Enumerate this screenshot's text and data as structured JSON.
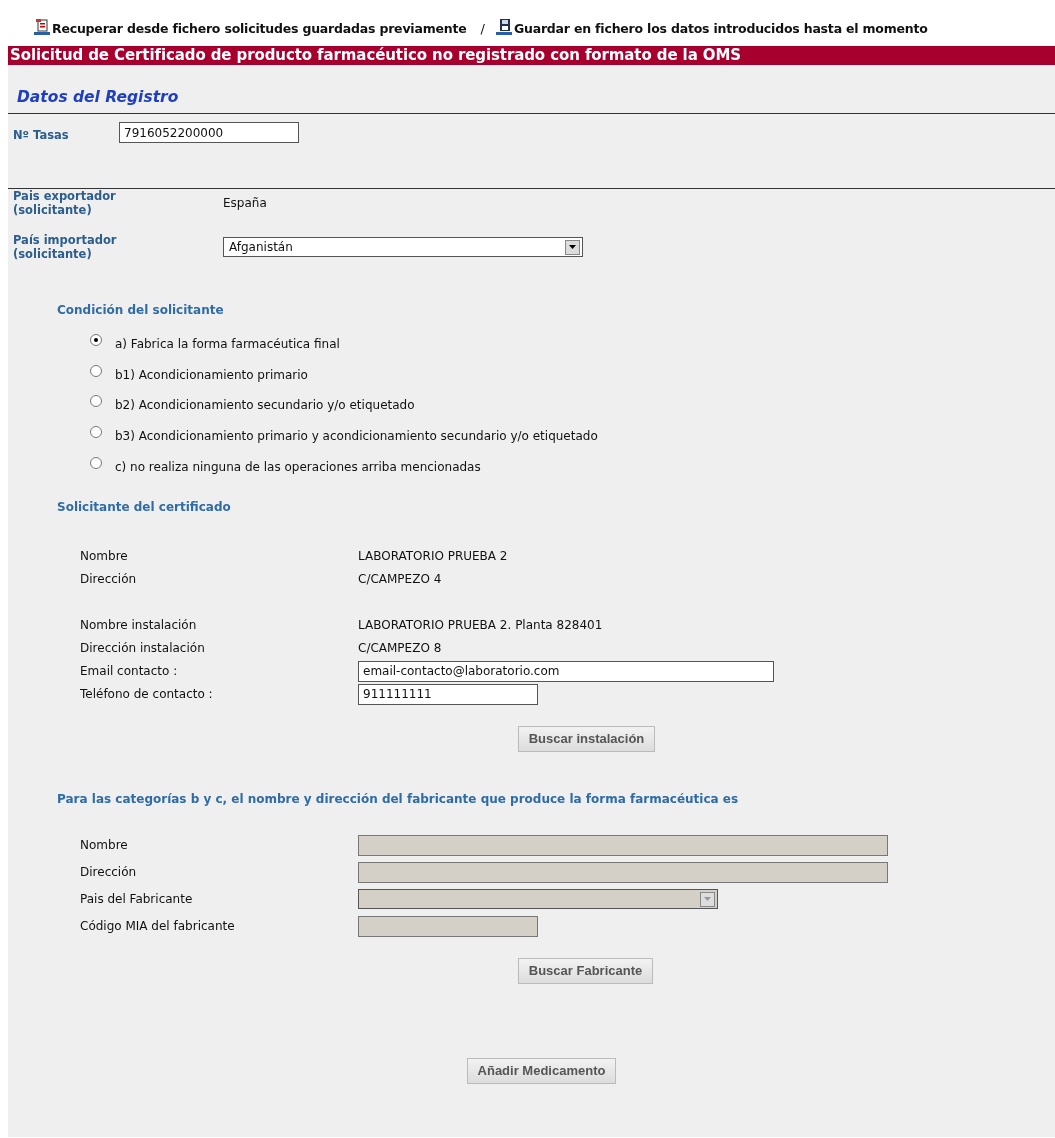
{
  "toolbar": {
    "links": [
      {
        "kind": "recover",
        "label": "Recuperar desde fichero solicitudes guardadas previamente"
      },
      {
        "kind": "save",
        "label": "Guardar en fichero los datos introducidos hasta el momento"
      }
    ],
    "separator": "/"
  },
  "title": "Solicitud de Certificado de producto farmacéutico no registrado con formato de la OMS",
  "registro": {
    "heading": "Datos del Registro",
    "tasas_label": "Nº Tasas",
    "tasas_value": "7916052200000"
  },
  "paises": [
    {
      "kind": "text",
      "label": "Pais exportador (solicitante)",
      "value": "España"
    },
    {
      "kind": "select",
      "label": "País importador (solicitante)",
      "value": "Afganistán"
    }
  ],
  "condicion": {
    "heading": "Condición del solicitante",
    "options": [
      {
        "label": "a) Fabrica la forma farmacéutica final",
        "selected": true
      },
      {
        "label": "b1) Acondicionamiento primario",
        "selected": false
      },
      {
        "label": "b2) Acondicionamiento secundario y/o etiquetado",
        "selected": false
      },
      {
        "label": "b3) Acondicionamiento primario y acondicionamiento secundario y/o etiquetado",
        "selected": false
      },
      {
        "label": "c) no realiza ninguna de las operaciones arriba mencionadas",
        "selected": false
      }
    ]
  },
  "solicitante": {
    "heading": "Solicitante del certificado",
    "groups": [
      [
        {
          "kind": "text",
          "label": "Nombre",
          "value": "LABORATORIO PRUEBA 2"
        },
        {
          "kind": "text",
          "label": "Dirección",
          "value": "C/CAMPEZO 4"
        }
      ],
      [
        {
          "kind": "text",
          "label": "Nombre instalación",
          "value": "LABORATORIO PRUEBA 2. Planta 828401"
        },
        {
          "kind": "text",
          "label": "Dirección instalación",
          "value": "C/CAMPEZO 8"
        },
        {
          "kind": "long_input",
          "label": "Email contacto :",
          "value": "email-contacto@laboratorio.com"
        },
        {
          "kind": "short_input",
          "label": "Teléfono de contacto :",
          "value": "911111111"
        }
      ]
    ],
    "button": "Buscar instalación"
  },
  "fabricante": {
    "heading": "Para las categorías b y c, el nombre y dirección del fabricante que produce la forma farmacéutica es",
    "rows": [
      {
        "kind": "full_input",
        "label": "Nombre",
        "disabled": true
      },
      {
        "kind": "full_input",
        "label": "Dirección",
        "disabled": true
      },
      {
        "kind": "select",
        "label": "Pais del Fabricante",
        "disabled": true
      },
      {
        "kind": "short_input",
        "label": "Código MIA del fabricante",
        "disabled": true
      }
    ],
    "button": "Buscar Fabricante"
  },
  "add_button": "Añadir Medicamento"
}
